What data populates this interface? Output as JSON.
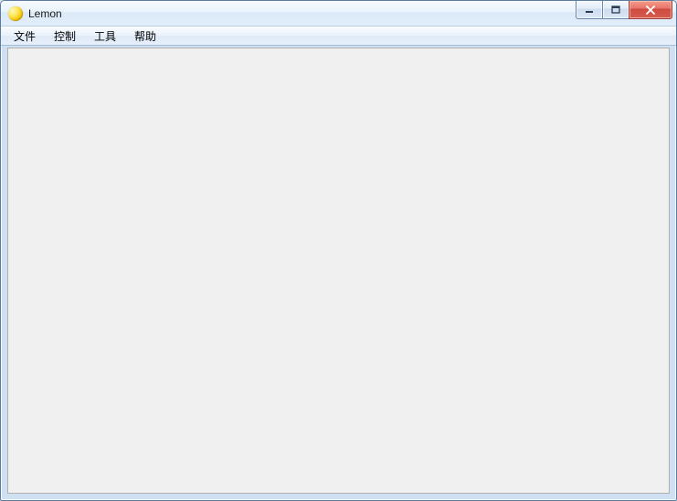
{
  "window": {
    "title": "Lemon",
    "icon": "lemon-icon"
  },
  "menu": {
    "items": [
      {
        "label": "文件"
      },
      {
        "label": "控制"
      },
      {
        "label": "工具"
      },
      {
        "label": "帮助"
      }
    ]
  },
  "controls": {
    "minimize": "minimize",
    "maximize": "maximize",
    "close": "close"
  }
}
